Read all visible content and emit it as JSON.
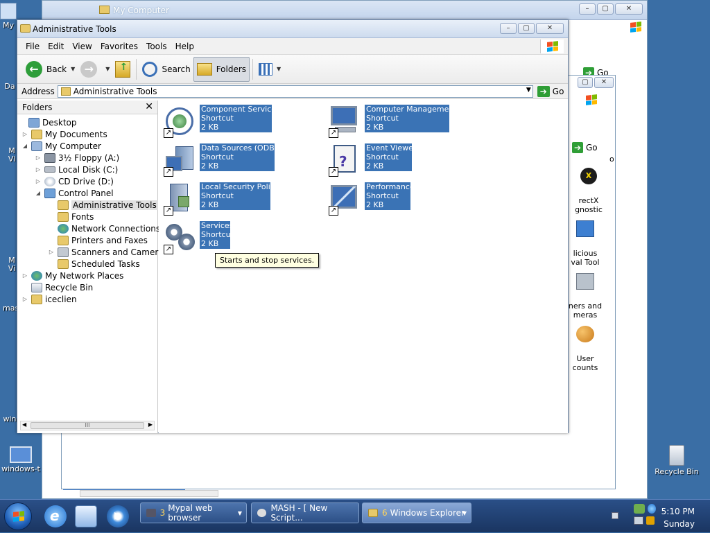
{
  "desktop": {
    "icons": [
      {
        "label": "My"
      },
      {
        "label": "Da"
      },
      {
        "label": "M\nVi"
      },
      {
        "label": "M\nVi"
      },
      {
        "label": "mas"
      },
      {
        "label": "win"
      },
      {
        "label": "windows-t"
      },
      {
        "label": "Recycle Bin"
      }
    ]
  },
  "bg_windows": {
    "my_computer_title": "My Computer",
    "go_label": "Go",
    "go_label_2": "Go",
    "partial_items": [
      "rectX\ngnostic",
      "licious\nval Tool",
      "ners and\nmeras",
      "User\ncounts"
    ],
    "partial_col": "o"
  },
  "window": {
    "title": "Administrative Tools",
    "menu": [
      "File",
      "Edit",
      "View",
      "Favorites",
      "Tools",
      "Help"
    ],
    "toolbar": {
      "back": "Back",
      "search": "Search",
      "folders": "Folders"
    },
    "address": {
      "label": "Address",
      "value": "Administrative Tools",
      "go": "Go"
    }
  },
  "folders_pane": {
    "header": "Folders",
    "tree": [
      {
        "label": "Desktop",
        "expander": ""
      },
      {
        "label": "My Documents",
        "expander": "▷"
      },
      {
        "label": "My Computer",
        "expander": "◢"
      },
      {
        "label": "3½ Floppy (A:)",
        "expander": "▷"
      },
      {
        "label": "Local Disk (C:)",
        "expander": "▷"
      },
      {
        "label": "CD Drive (D:)",
        "expander": "▷"
      },
      {
        "label": "Control Panel",
        "expander": "◢"
      },
      {
        "label": "Administrative Tools",
        "expander": ""
      },
      {
        "label": "Fonts",
        "expander": ""
      },
      {
        "label": "Network Connections",
        "expander": ""
      },
      {
        "label": "Printers and Faxes",
        "expander": ""
      },
      {
        "label": "Scanners and Cameras",
        "expander": "▷"
      },
      {
        "label": "Scheduled Tasks",
        "expander": ""
      },
      {
        "label": "My Network Places",
        "expander": "▷"
      },
      {
        "label": "Recycle Bin",
        "expander": ""
      },
      {
        "label": "iceclien",
        "expander": "▷"
      }
    ],
    "scroll_grip": "III"
  },
  "content": {
    "items": [
      {
        "name": "Component Services",
        "type": "Shortcut",
        "size": "2 KB"
      },
      {
        "name": "Computer Management",
        "type": "Shortcut",
        "size": "2 KB"
      },
      {
        "name": "Data Sources (ODBC)",
        "type": "Shortcut",
        "size": "2 KB"
      },
      {
        "name": "Event Viewer",
        "type": "Shortcut",
        "size": "2 KB"
      },
      {
        "name": "Local Security Policy",
        "type": "Shortcut",
        "size": "2 KB"
      },
      {
        "name": "Performance",
        "type": "Shortcut",
        "size": "2 KB"
      },
      {
        "name": "Services",
        "type": "Shortcut",
        "size": "2 KB"
      }
    ],
    "tooltip": "Starts and stop services."
  },
  "taskbar": {
    "tasks": [
      {
        "count": "3",
        "label": "Mypal web browser"
      },
      {
        "count": "",
        "label": "MASH - [ New Script..."
      },
      {
        "count": "6",
        "label": "Windows Explorer"
      }
    ],
    "clock_time": "5:10 PM",
    "clock_day": "Sunday"
  },
  "colors": {
    "desktop": "#3a6ea5",
    "selection": "#3a73b5",
    "taskbar": "#1f3d70"
  }
}
